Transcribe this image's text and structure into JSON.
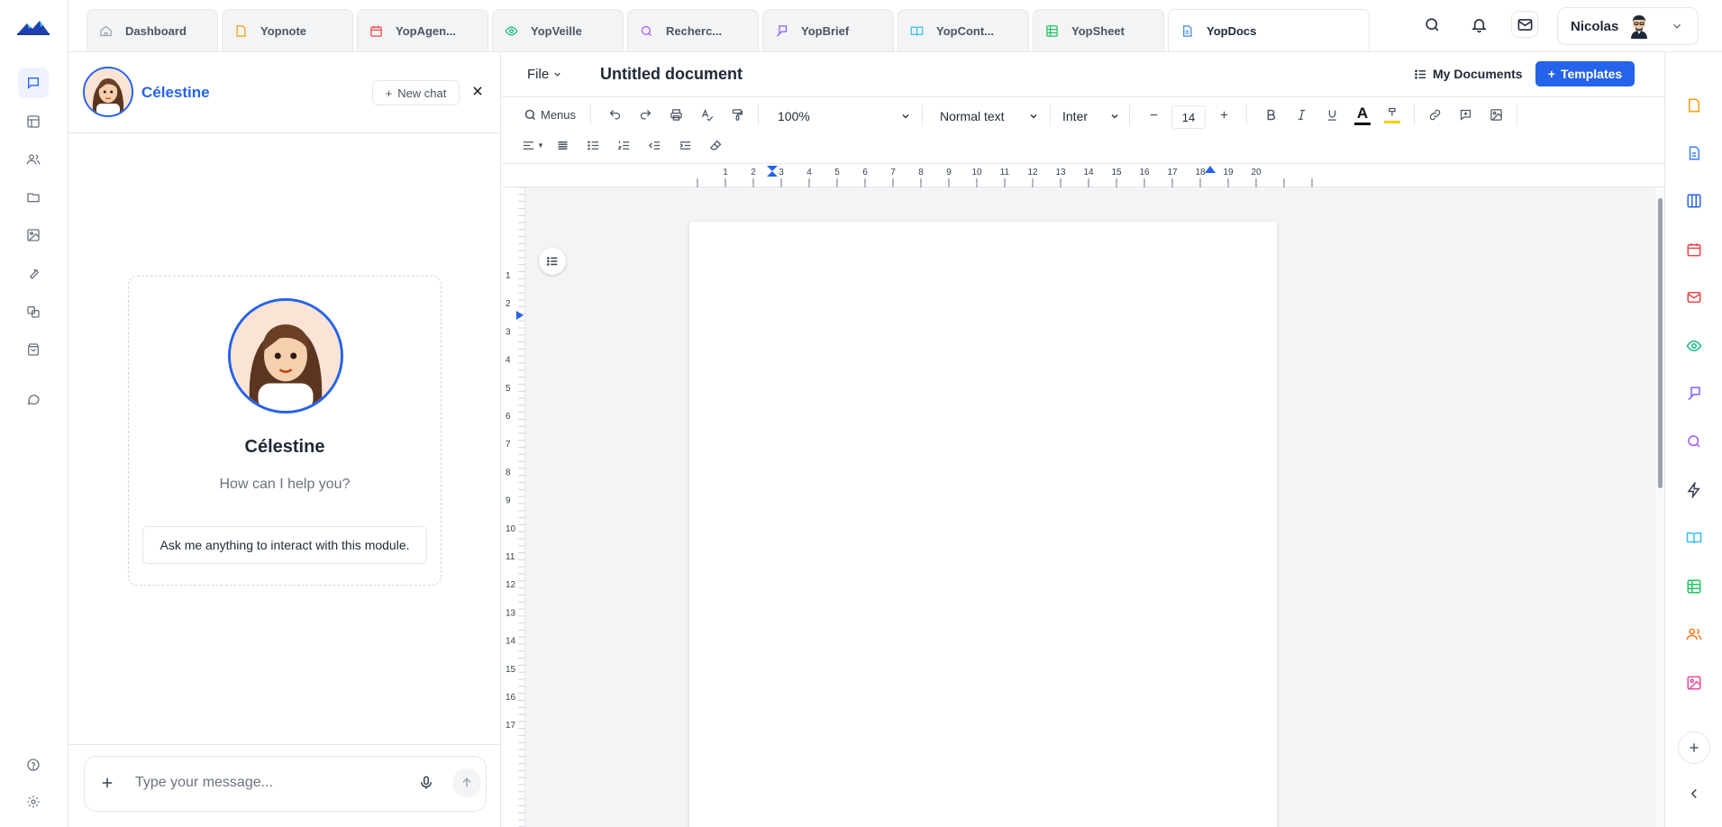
{
  "tabs": [
    {
      "label": "Dashboard",
      "icon": "home-icon",
      "color": "#9ca3af"
    },
    {
      "label": "Yopnote",
      "icon": "note-icon",
      "color": "#f59e0b"
    },
    {
      "label": "YopAgen...",
      "icon": "calendar-icon",
      "color": "#ef4444"
    },
    {
      "label": "YopVeille",
      "icon": "eye-icon",
      "color": "#10b981"
    },
    {
      "label": "Recherc...",
      "icon": "search-icon",
      "color": "#a855f7"
    },
    {
      "label": "YopBrief",
      "icon": "brief-icon",
      "color": "#8b5cf6"
    },
    {
      "label": "YopCont...",
      "icon": "book-icon",
      "color": "#38bdf8"
    },
    {
      "label": "YopSheet",
      "icon": "sheet-icon",
      "color": "#22c55e"
    },
    {
      "label": "YopDocs",
      "icon": "doc-icon",
      "color": "#3b82f6"
    }
  ],
  "user": {
    "name": "Nicolas"
  },
  "chat": {
    "assistant_name": "Célestine",
    "new_chat_label": "New chat",
    "greeting": "How can I help you?",
    "hint": "Ask me anything to interact with this module.",
    "input_placeholder": "Type your message..."
  },
  "editor": {
    "file_label": "File",
    "doc_title": "Untitled document",
    "my_documents_label": "My Documents",
    "templates_label": "Templates",
    "menus_label": "Menus",
    "zoom": "100%",
    "style": "Normal text",
    "font": "Inter",
    "font_size": "14"
  },
  "ruler": {
    "h_ticks": [
      "1",
      "2",
      "3",
      "4",
      "5",
      "6",
      "7",
      "8",
      "9",
      "10",
      "11",
      "12",
      "13",
      "14",
      "15",
      "16",
      "17",
      "18",
      "19",
      "20"
    ],
    "v_ticks": [
      "1",
      "2",
      "3",
      "4",
      "5",
      "6",
      "7",
      "8",
      "9",
      "10",
      "11",
      "12",
      "13",
      "14",
      "15",
      "16",
      "17"
    ]
  },
  "colors": {
    "accent": "#2563eb"
  }
}
